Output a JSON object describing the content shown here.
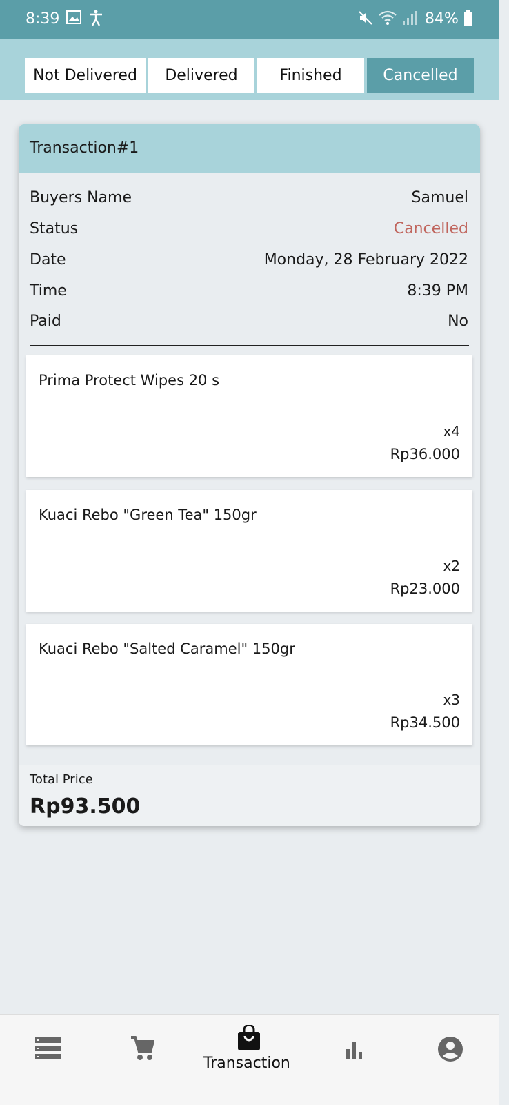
{
  "status_bar": {
    "time": "8:39",
    "battery": "84%",
    "icons": [
      "image-icon",
      "accessibility-icon",
      "mute-icon",
      "wifi-icon",
      "signal-icon",
      "battery-icon"
    ]
  },
  "tabs": [
    {
      "label": "Not Delivered",
      "active": false
    },
    {
      "label": "Delivered",
      "active": false
    },
    {
      "label": "Finished",
      "active": false
    },
    {
      "label": "Cancelled",
      "active": true
    }
  ],
  "transaction": {
    "title": "Transaction#1",
    "fields": {
      "buyer_label": "Buyers Name",
      "buyer_value": "Samuel",
      "status_label": "Status",
      "status_value": "Cancelled",
      "date_label": "Date",
      "date_value": "Monday, 28 February 2022",
      "time_label": "Time",
      "time_value": "8:39 PM",
      "paid_label": "Paid",
      "paid_value": "No"
    },
    "items": [
      {
        "name": "Prima Protect Wipes 20 s",
        "qty": "x4",
        "price": "Rp36.000"
      },
      {
        "name": "Kuaci Rebo \"Green Tea\" 150gr",
        "qty": "x2",
        "price": "Rp23.000"
      },
      {
        "name": "Kuaci Rebo \"Salted Caramel\" 150gr",
        "qty": "x3",
        "price": "Rp34.500"
      }
    ],
    "total_label": "Total Price",
    "total_value": "Rp93.500"
  },
  "colors": {
    "status_bar": "#5b9ea8",
    "tab_bar": "#a8d3da",
    "active_tab": "#5b9ea8",
    "cancelled_text": "#c0665e"
  },
  "bottom_nav": {
    "items": [
      {
        "icon": "list-icon"
      },
      {
        "icon": "cart-icon"
      },
      {
        "icon": "shopping-bag-icon",
        "label": "Transaction",
        "active": true
      },
      {
        "icon": "bar-chart-icon"
      },
      {
        "icon": "account-icon"
      }
    ]
  }
}
